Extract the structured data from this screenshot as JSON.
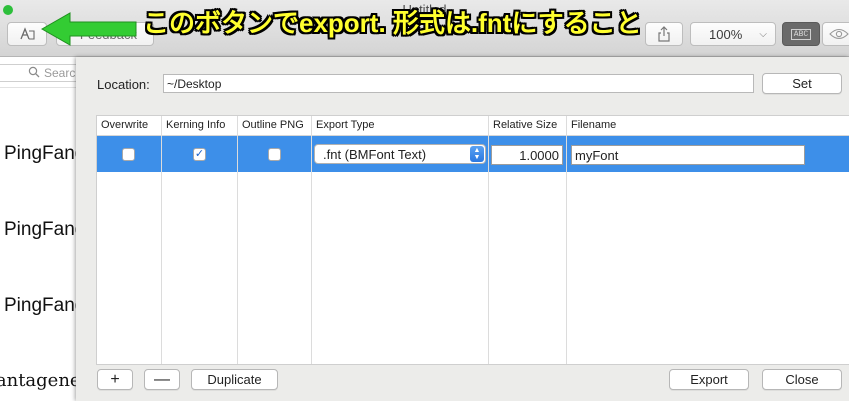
{
  "window": {
    "title": "Untitled"
  },
  "toolbar": {
    "feedback_label": "Feedback",
    "zoom_value": "100%",
    "abc_label": "ABC"
  },
  "annotation": {
    "text": "このボタンでexport. 形式は.fntにすること",
    "text_color": "#ffff2e",
    "arrow_color": "#33cc33"
  },
  "sidebar": {
    "search_placeholder": "Search",
    "font_samples": [
      "PingFang",
      "PingFang",
      "PingFang",
      "Plantagenet"
    ]
  },
  "sheet": {
    "location_label": "Location:",
    "location_value": "~/Desktop",
    "set_label": "Set",
    "columns": [
      "Overwrite",
      "Kerning Info",
      "Outline PNG",
      "Export Type",
      "Relative Size",
      "Filename"
    ],
    "rows": [
      {
        "overwrite": false,
        "kerning_info": true,
        "outline_png": false,
        "export_type": ".fnt (BMFont Text)",
        "relative_size": "1.0000",
        "filename": "myFont"
      }
    ],
    "add_label": "+",
    "remove_label": "—",
    "duplicate_label": "Duplicate",
    "export_label": "Export",
    "close_label": "Close",
    "selection_color": "#3d8fe9"
  }
}
